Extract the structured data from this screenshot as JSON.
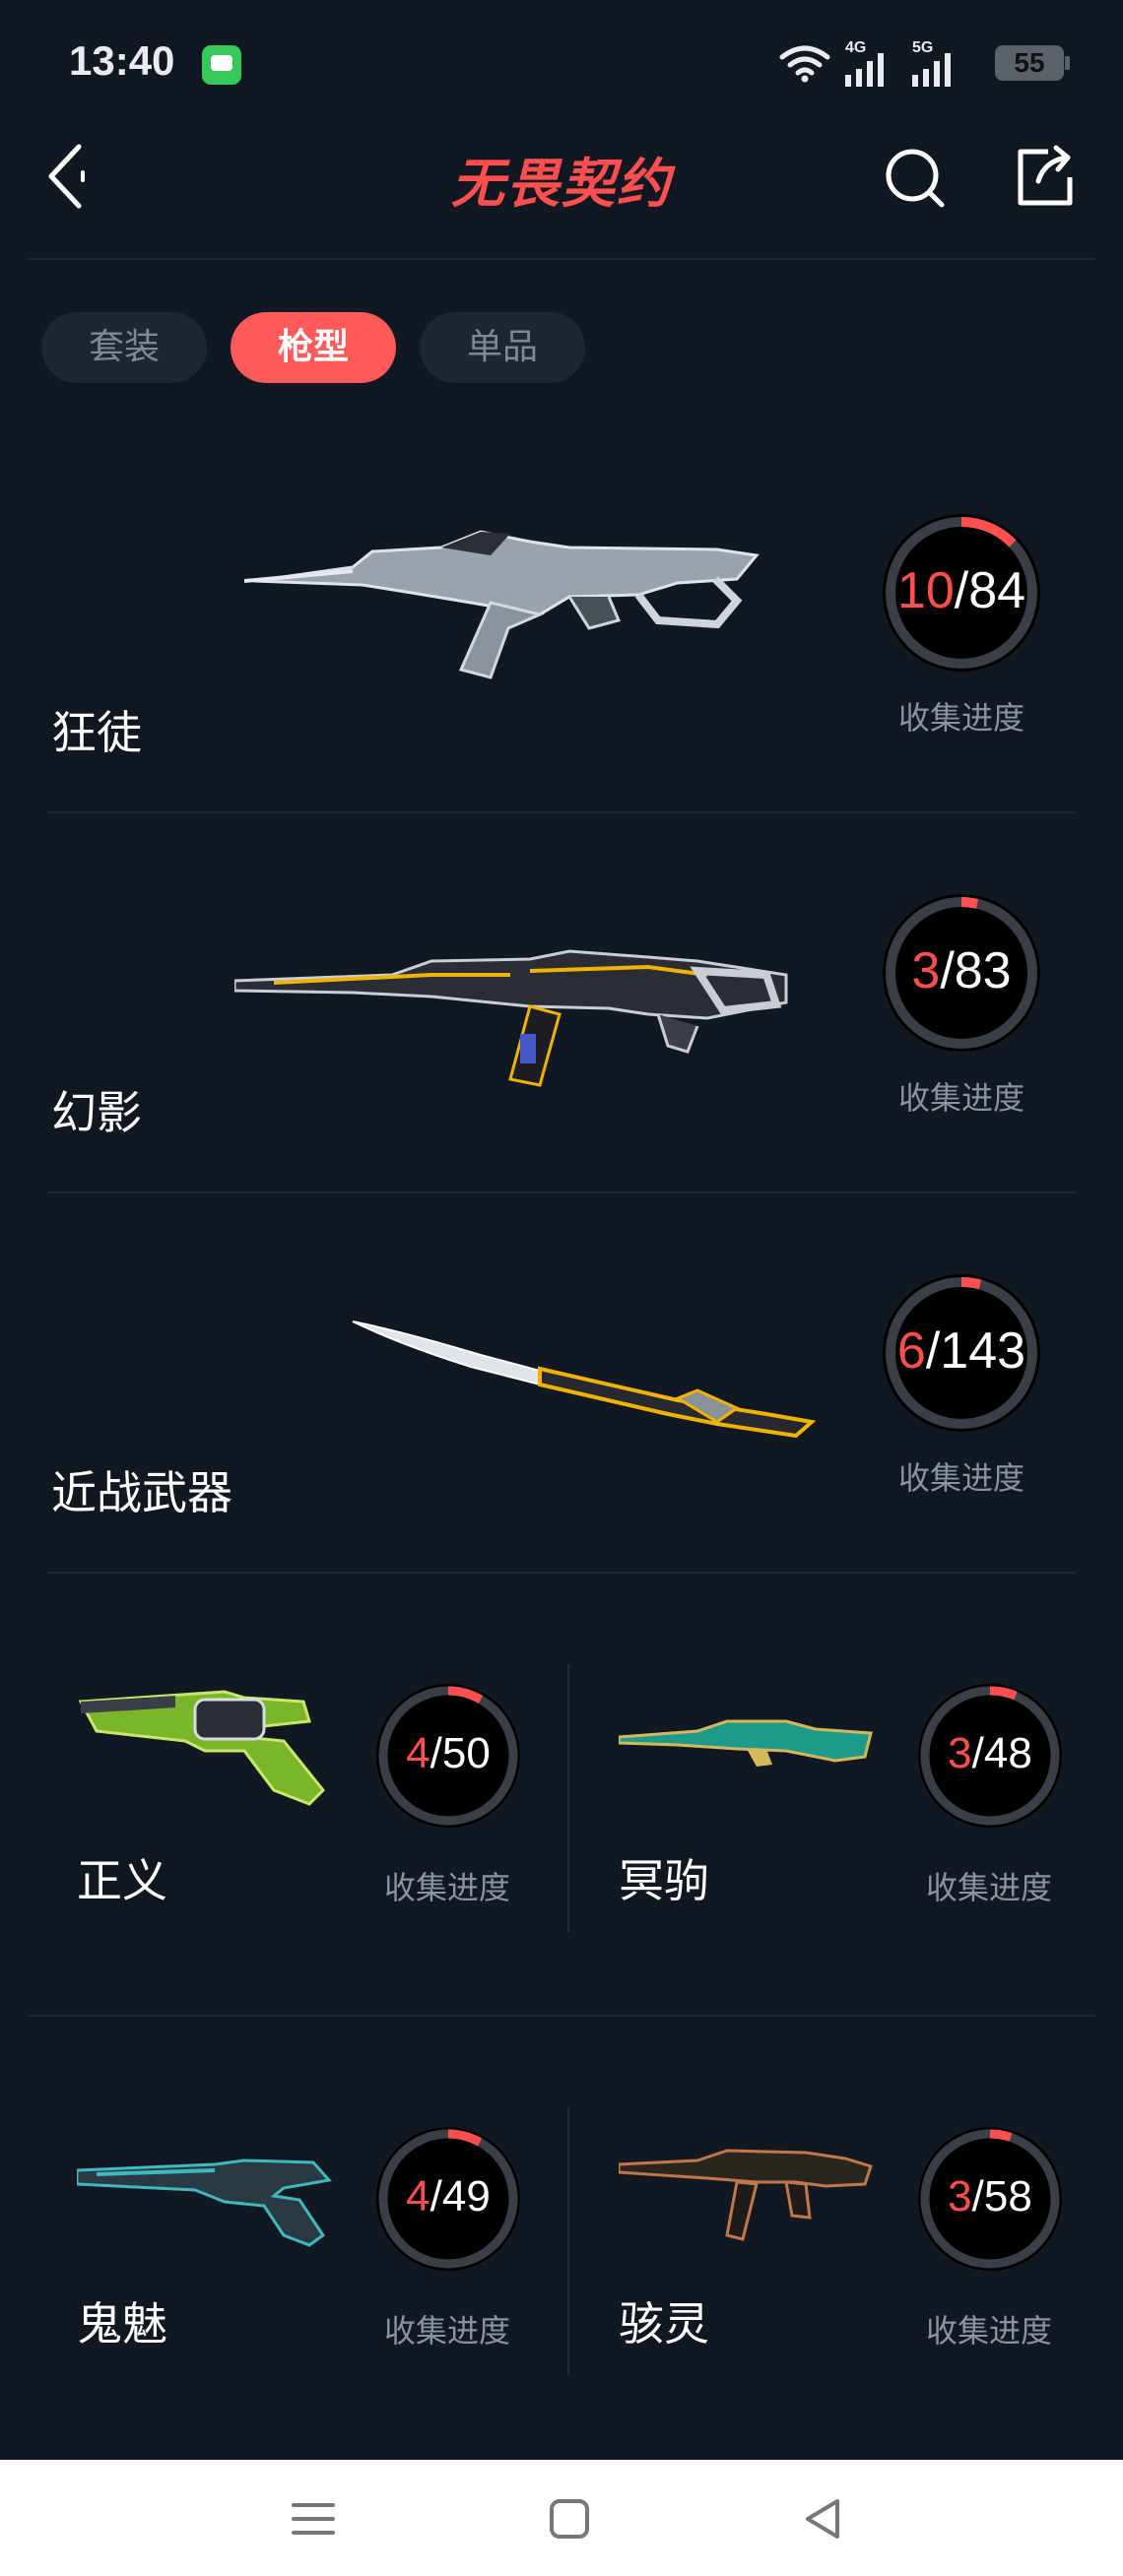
{
  "status_bar": {
    "time": "13:40",
    "network_1": "4G",
    "network_2": "5G",
    "battery": "55",
    "icons": [
      "message-app-icon",
      "wifi-icon",
      "signal-icon",
      "signal-icon",
      "battery-icon"
    ]
  },
  "header": {
    "title": "无畏契约",
    "icons": [
      "back-icon",
      "search-icon",
      "share-icon"
    ]
  },
  "tabs": [
    {
      "label": "套装",
      "active": false
    },
    {
      "label": "枪型",
      "active": true
    },
    {
      "label": "单品",
      "active": false
    }
  ],
  "progress_label": "收集进度",
  "weapons_large": [
    {
      "name": "狂徒",
      "collected": "10",
      "total": "/84"
    },
    {
      "name": "幻影",
      "collected": "3",
      "total": "/83"
    },
    {
      "name": "近战武器",
      "collected": "6",
      "total": "/143"
    }
  ],
  "weapons_small": [
    {
      "name": "正义",
      "collected": "4",
      "total": "/50"
    },
    {
      "name": "冥驹",
      "collected": "3",
      "total": "/48"
    },
    {
      "name": "鬼魅",
      "collected": "4",
      "total": "/49"
    },
    {
      "name": "骇灵",
      "collected": "3",
      "total": "/58"
    }
  ],
  "colors": {
    "background": "#111821",
    "accent": "#ff4f4f",
    "tab_inactive": "#1f2630",
    "label_gray": "#8b939d"
  },
  "nav": {
    "icons": [
      "menu-icon",
      "home-icon",
      "back-triangle-icon"
    ]
  }
}
